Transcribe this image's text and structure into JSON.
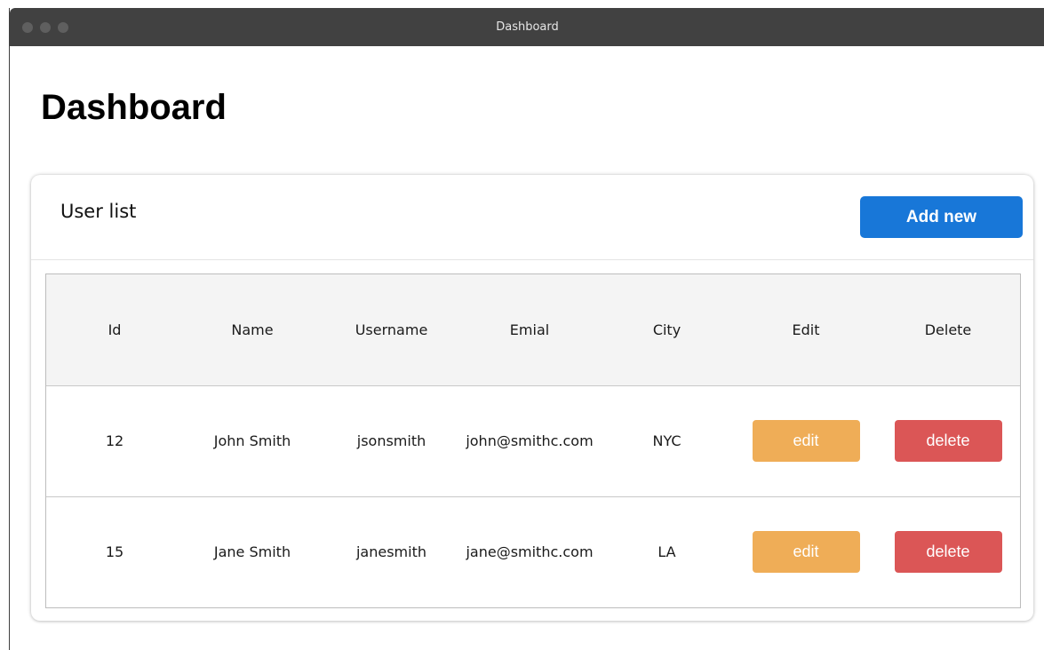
{
  "window": {
    "title": "Dashboard"
  },
  "page": {
    "title": "Dashboard"
  },
  "card": {
    "title": "User list",
    "add_button_label": "Add new"
  },
  "table": {
    "headers": [
      "Id",
      "Name",
      "Username",
      "Emial",
      "City",
      "Edit",
      "Delete"
    ],
    "rows": [
      {
        "id": "12",
        "name": "John Smith",
        "username": "jsonsmith",
        "email": "john@smithc.com",
        "city": "NYC",
        "edit_label": "edit",
        "delete_label": "delete"
      },
      {
        "id": "15",
        "name": "Jane Smith",
        "username": "janesmith",
        "email": "jane@smithc.com",
        "city": "LA",
        "edit_label": "edit",
        "delete_label": "delete"
      }
    ]
  },
  "colors": {
    "titlebar": "#414141",
    "primary": "#1877d8",
    "edit": "#efad57",
    "delete": "#db5656",
    "header_bg": "#f4f4f4"
  }
}
